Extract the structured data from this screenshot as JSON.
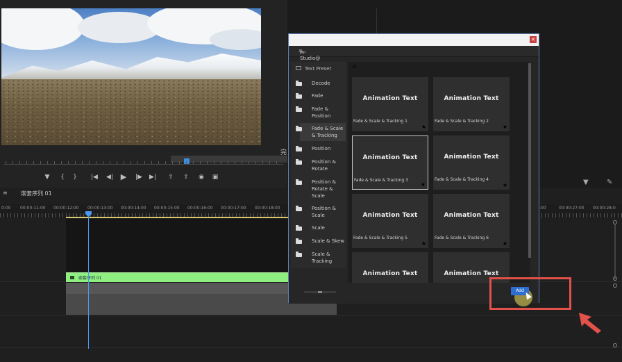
{
  "monitor": {
    "side_char": "完",
    "controls": [
      "marker-icon",
      "mark-in-icon",
      "mark-out-icon",
      "go-to-in-icon",
      "step-back-icon",
      "play-icon",
      "step-forward-icon",
      "go-to-out-icon",
      "lift-icon",
      "extract-icon",
      "export-frame-icon",
      "comparison-icon"
    ]
  },
  "timeline": {
    "sequence_tab": "嵌套序列 01",
    "timecodes": [
      "0:00",
      "00:00:11:00",
      "00:00:12:00",
      "00:00:13:00",
      "00:00:14:00",
      "00:00:15:00",
      "00:00:16:00",
      "00:00:17:00",
      "00:00:18:00",
      ":00",
      "00:00:27:00",
      "00:00:28:0"
    ],
    "clip_label": "嵌套序列 01"
  },
  "dialog": {
    "header_title": "Pr-Studio@微信公众号: 后期大侠",
    "header_menu": "≡",
    "close_label": "×",
    "sidebar_title": "Text Preset",
    "folders": [
      "Decode",
      "Fade",
      "Fade & Position",
      "Fade & Scale & Tracking",
      "Position",
      "Position & Rotate",
      "Position & Rotate & Scale",
      "Position & Scale",
      "Scale",
      "Scale & Skew",
      "Scale & Tracking"
    ],
    "selected_folder": "Fade & Scale & Tracking",
    "presets": [
      {
        "title": "Animation Text",
        "label": "Fade & Scale & Tracking 1"
      },
      {
        "title": "Animation Text",
        "label": "Fade & Scale & Tracking 2"
      },
      {
        "title": "Animation Text",
        "label": "Fade & Scale & Tracking 3"
      },
      {
        "title": "Animation Text",
        "label": "Fade & Scale & Tracking 4"
      },
      {
        "title": "Animation Text",
        "label": "Fade & Scale & Tracking 5"
      },
      {
        "title": "Animation Text",
        "label": "Fade & Scale & Tracking 6"
      },
      {
        "title": "Animation Text",
        "label": ""
      },
      {
        "title": "Animation Text",
        "label": ""
      }
    ],
    "add_button": "Add"
  },
  "colors": {
    "accent_blue": "#4a9bf5",
    "clip_green": "#8fef80",
    "highlight_red": "#e3524a",
    "add_button": "#2c6fd0"
  }
}
